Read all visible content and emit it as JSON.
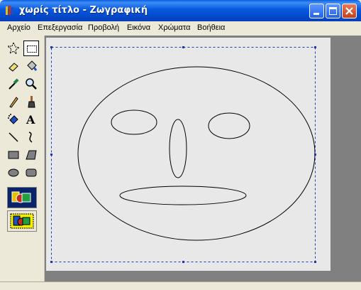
{
  "window": {
    "title": "χωρίς τίτλο - Ζωγραφική"
  },
  "title_buttons": {
    "minimize": "minimize-icon",
    "maximize": "maximize-icon",
    "close": "close-icon"
  },
  "menu": {
    "items": [
      "Αρχείο",
      "Επεξεργασία",
      "Προβολή",
      "Εικόνα",
      "Χρώματα",
      "Βοήθεια"
    ]
  },
  "toolbox": {
    "tools": [
      {
        "icon": "free-form-select-icon"
      },
      {
        "icon": "rect-select-icon",
        "selected": true
      },
      {
        "icon": "eraser-icon"
      },
      {
        "icon": "fill-bucket-icon"
      },
      {
        "icon": "pick-color-icon"
      },
      {
        "icon": "magnifier-icon"
      },
      {
        "icon": "pencil-icon"
      },
      {
        "icon": "brush-icon"
      },
      {
        "icon": "airbrush-icon"
      },
      {
        "icon": "text-icon",
        "glyph": "A"
      },
      {
        "icon": "line-icon"
      },
      {
        "icon": "curve-icon"
      },
      {
        "icon": "rectangle-icon"
      },
      {
        "icon": "polygon-icon"
      },
      {
        "icon": "ellipse-icon"
      },
      {
        "icon": "rounded-rect-icon"
      }
    ],
    "fill_options": [
      "outline-fill-option",
      "fill-only-option"
    ]
  },
  "colors": {
    "titlebar": "#0a5fe0",
    "close_button": "#c6401c",
    "canvas_bg": "#e8e8e8",
    "workspace_bg": "#808080",
    "selection_border": "#1a3bb0",
    "drawing_stroke": "#000000"
  },
  "canvas": {
    "drawing": "face-drawing",
    "selection": "dashed-selection-rectangle"
  }
}
